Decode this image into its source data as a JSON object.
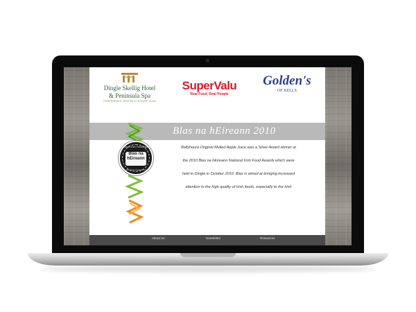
{
  "sponsors": {
    "dingle": {
      "name_line1": "Dingle Skellig Hotel",
      "name_line2": "& Peninsula Spa",
      "subtitle": "CONFERENCE CENTRE & LEISURE CLUB"
    },
    "supervalu": {
      "name": "SuperValu",
      "tagline": "Real Food, Real People"
    },
    "goldens": {
      "name": "Golden's",
      "subtitle": "OF KELLS"
    }
  },
  "banner": {
    "title": "Blas na hEireann 2010"
  },
  "badge": {
    "ring_text": "Blas na hEireann",
    "center_line1": "Blas na",
    "center_line2": "hEireann",
    "top_text": "National Irish Food Awards",
    "bottom_text": "www.irishfoodawards.com"
  },
  "article": {
    "lines": [
      "Ballyhoura Original Mulled Apple Juice was a Silver Award winner at",
      "the 2010 Blas na hEireann National Irish Food Awards which were",
      "held in Dingle in October 2010. Blas is aimed at bringing increased",
      "attention to the high quality of Irish foods, especially to the Irish"
    ]
  },
  "footer": {
    "links": [
      "About Us",
      "Newsletter",
      "Resources"
    ]
  },
  "colors": {
    "supervalu_red": "#d6182a",
    "goldens_blue": "#2d3f8a",
    "dingle_green": "#2f5a3a",
    "banner_gray": "#b9b9b9",
    "footer_dark": "#4a4a4a"
  },
  "icons": {
    "dingle_logo_mark": "temple-icon",
    "badge": "award-seal-icon"
  }
}
